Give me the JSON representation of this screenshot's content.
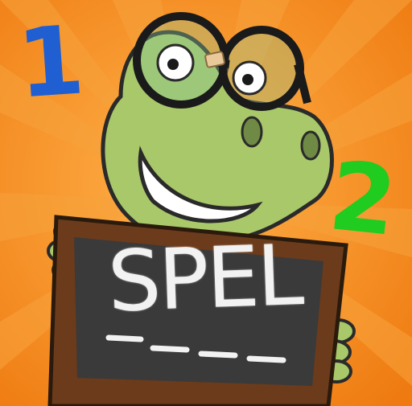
{
  "artwork": {
    "numbers": {
      "left": "1",
      "right": "2"
    },
    "board_word": "SPEL",
    "underline_count": 4,
    "character": "dinosaur-with-glasses-icon"
  },
  "colors": {
    "background": "#f28a1c",
    "number_left": "#1f5fd1",
    "number_right": "#1fcc1f",
    "dino_skin": "#a8c86a",
    "board_frame": "#6b3b1c",
    "chalkboard": "#3a3a3a",
    "chalk": "#f2f2f2"
  }
}
